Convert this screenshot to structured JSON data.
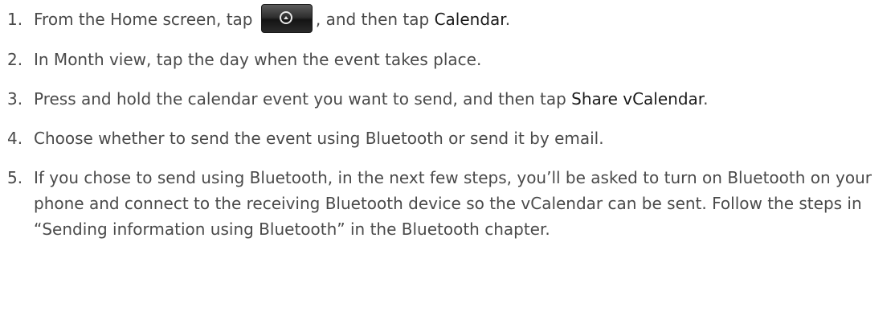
{
  "steps": [
    {
      "number": "1.",
      "before": "From the Home screen, tap",
      "icon": "all-apps-home-button-icon",
      "middle": ", and then tap ",
      "highlight": "Calendar",
      "after": "."
    },
    {
      "number": "2.",
      "text": "In Month view, tap the day when the event takes place."
    },
    {
      "number": "3.",
      "before": "Press and hold the calendar event you want to send, and then tap ",
      "highlight": "Share vCalendar",
      "after": "."
    },
    {
      "number": "4.",
      "text": "Choose whether to send the event using Bluetooth or send it by email."
    },
    {
      "number": "5.",
      "text": "If you chose to send using Bluetooth, in the next few steps, you’ll be asked to turn on Bluetooth on your phone and connect to the receiving Bluetooth device so the vCalendar can be sent. Follow the steps in “Sending information using Bluetooth” in the Bluetooth chapter."
    }
  ],
  "colors": {
    "text": "#4a4a4a",
    "highlight": "#1a1a1a"
  }
}
